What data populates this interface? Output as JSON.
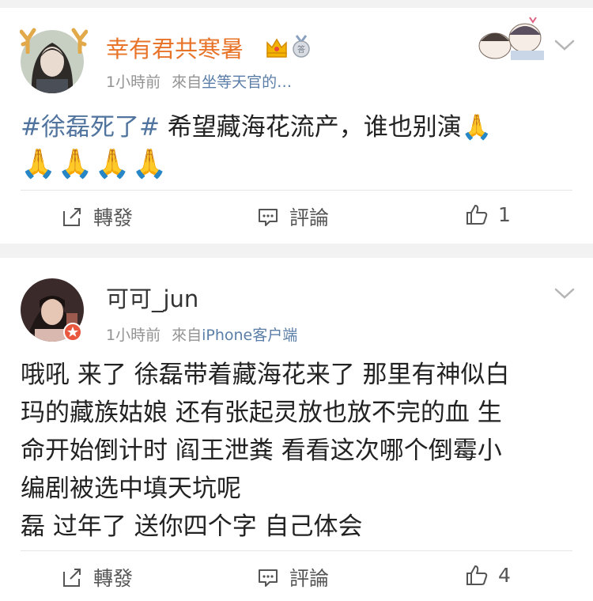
{
  "posts": [
    {
      "username": "幸有君共寒暑",
      "username_color": "#e8742a",
      "time": "1小時前",
      "from_label": "來自",
      "source": "坐等天官的…",
      "hashtag": "#徐磊死了#",
      "text": "  希望藏海花流产，谁也别演🙏",
      "emoji_row": "🙏🙏🙏🙏",
      "repost_label": "轉發",
      "comment_label": "評論",
      "like_count": "1"
    },
    {
      "username": "可可_jun",
      "username_color": "#333333",
      "time": "1小時前",
      "from_label": "來自",
      "source": "iPhone客户端",
      "lines": [
        "哦吼 来了 徐磊带着藏海花来了 那里有神似白",
        "玛的藏族姑娘 还有张起灵放也放不完的血 生",
        "命开始倒计时 阎王泄粪 看看这次哪个倒霉小",
        "编剧被选中填天坑呢",
        "磊 过年了 送你四个字 自己体会"
      ],
      "repost_label": "轉發",
      "comment_label": "評論",
      "like_count": "4"
    }
  ],
  "colors": {
    "link": "#5b7ea8",
    "hashtag": "#50749e",
    "meta": "#939393",
    "background": "#f2f2f2"
  },
  "icons": [
    "antler-ears-icon",
    "crown-icon",
    "medal-icon",
    "vip-badge-icon",
    "repost-icon",
    "comment-icon",
    "like-icon",
    "chevron-down-icon"
  ]
}
